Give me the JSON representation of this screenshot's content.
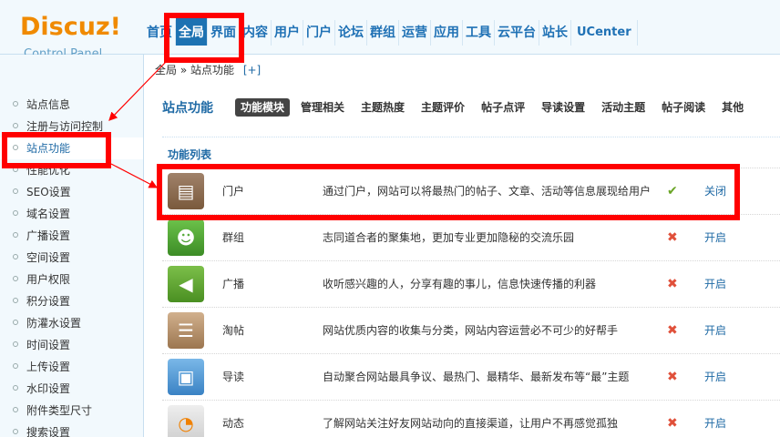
{
  "app": {
    "logo": "Discuz!",
    "subtitle": "Control Panel"
  },
  "nav": [
    "首页",
    "全局",
    "界面",
    "内容",
    "用户",
    "门户",
    "论坛",
    "群组",
    "运营",
    "应用",
    "工具",
    "云平台",
    "站长",
    "UCenter"
  ],
  "breadcrumb": {
    "text": "全局 » 站点功能",
    "plus": "[+]"
  },
  "sidebar": [
    "站点信息",
    "注册与访问控制",
    "站点功能",
    "性能优化",
    "SEO设置",
    "域名设置",
    "广播设置",
    "空间设置",
    "用户权限",
    "积分设置",
    "防灌水设置",
    "时间设置",
    "上传设置",
    "水印设置",
    "附件类型尺寸",
    "搜索设置"
  ],
  "section": {
    "title": "站点功能",
    "tabs": [
      "功能模块",
      "管理相关",
      "主题热度",
      "主题评价",
      "帖子点评",
      "导读设置",
      "活动主题",
      "帖子阅读",
      "其他"
    ]
  },
  "list": {
    "header": "功能列表",
    "rows": [
      {
        "icon": "portal-icon",
        "name": "门户",
        "desc": "通过门户，网站可以将最热门的帖子、文章、活动等信息展现给用户",
        "status": "✔",
        "action": "关闭"
      },
      {
        "icon": "group-icon",
        "name": "群组",
        "desc": "志同道合者的聚集地，更加专业更加隐秘的交流乐园",
        "status": "✖",
        "action": "开启"
      },
      {
        "icon": "broadcast-icon",
        "name": "广播",
        "desc": "收听感兴趣的人，分享有趣的事儿，信息快速传播的利器",
        "status": "✖",
        "action": "开启"
      },
      {
        "icon": "collect-icon",
        "name": "淘帖",
        "desc": "网站优质内容的收集与分类，网站内容运营必不可少的好帮手",
        "status": "✖",
        "action": "开启"
      },
      {
        "icon": "guide-icon",
        "name": "导读",
        "desc": "自动聚合网站最具争议、最热门、最精华、最新发布等“最”主题",
        "status": "✖",
        "action": "开启"
      },
      {
        "icon": "rss-icon",
        "name": "动态",
        "desc": "了解网站关注好友网站动向的直接渠道，让用户不再感觉孤独",
        "status": "✖",
        "action": "开启"
      }
    ]
  }
}
